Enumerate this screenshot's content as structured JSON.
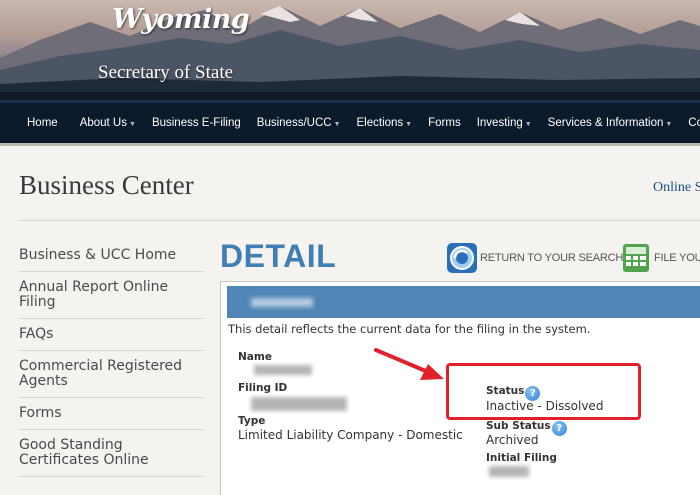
{
  "banner": {
    "logo_script": "Wyoming",
    "logo_subtitle": "Secretary of State"
  },
  "nav": {
    "items": [
      {
        "label": "Home",
        "has_caret": false
      },
      {
        "label": "About Us",
        "has_caret": true
      },
      {
        "label": "Business E-Filing",
        "has_caret": false
      },
      {
        "label": "Business/UCC",
        "has_caret": true
      },
      {
        "label": "Elections",
        "has_caret": true
      },
      {
        "label": "Forms",
        "has_caret": false
      },
      {
        "label": "Investing",
        "has_caret": true
      },
      {
        "label": "Services & Information",
        "has_caret": true
      },
      {
        "label": "Contac",
        "has_caret": false
      }
    ]
  },
  "header": {
    "title": "Business Center",
    "online_link": "Online S"
  },
  "sidebar": {
    "items": [
      "Business & UCC Home",
      "Annual Report Online Filing",
      "FAQs",
      "Commercial Registered Agents",
      "Forms",
      "Good Standing Certificates Online"
    ]
  },
  "detail": {
    "heading": "DETAIL",
    "return_label": "RETURN TO YOUR SEARCH",
    "file_label": "FILE YOUR",
    "description": "This detail reflects the current data for the filing in the system.",
    "name_label": "Name",
    "filing_id_label": "Filing ID",
    "type_label": "Type",
    "type_value": "Limited Liability Company - Domestic",
    "status_label": "Status",
    "status_value": "Inactive - Dissolved",
    "sub_status_label": "Sub Status",
    "sub_status_value": "Archived",
    "initial_filing_label": "Initial Filing",
    "help_glyph": "?"
  },
  "colors": {
    "nav_bg": "#0c1a2c",
    "detail_heading": "#3f7fb3",
    "panel_bar": "#4f86b6",
    "highlight": "#e0202a",
    "link": "#1d4f86"
  }
}
